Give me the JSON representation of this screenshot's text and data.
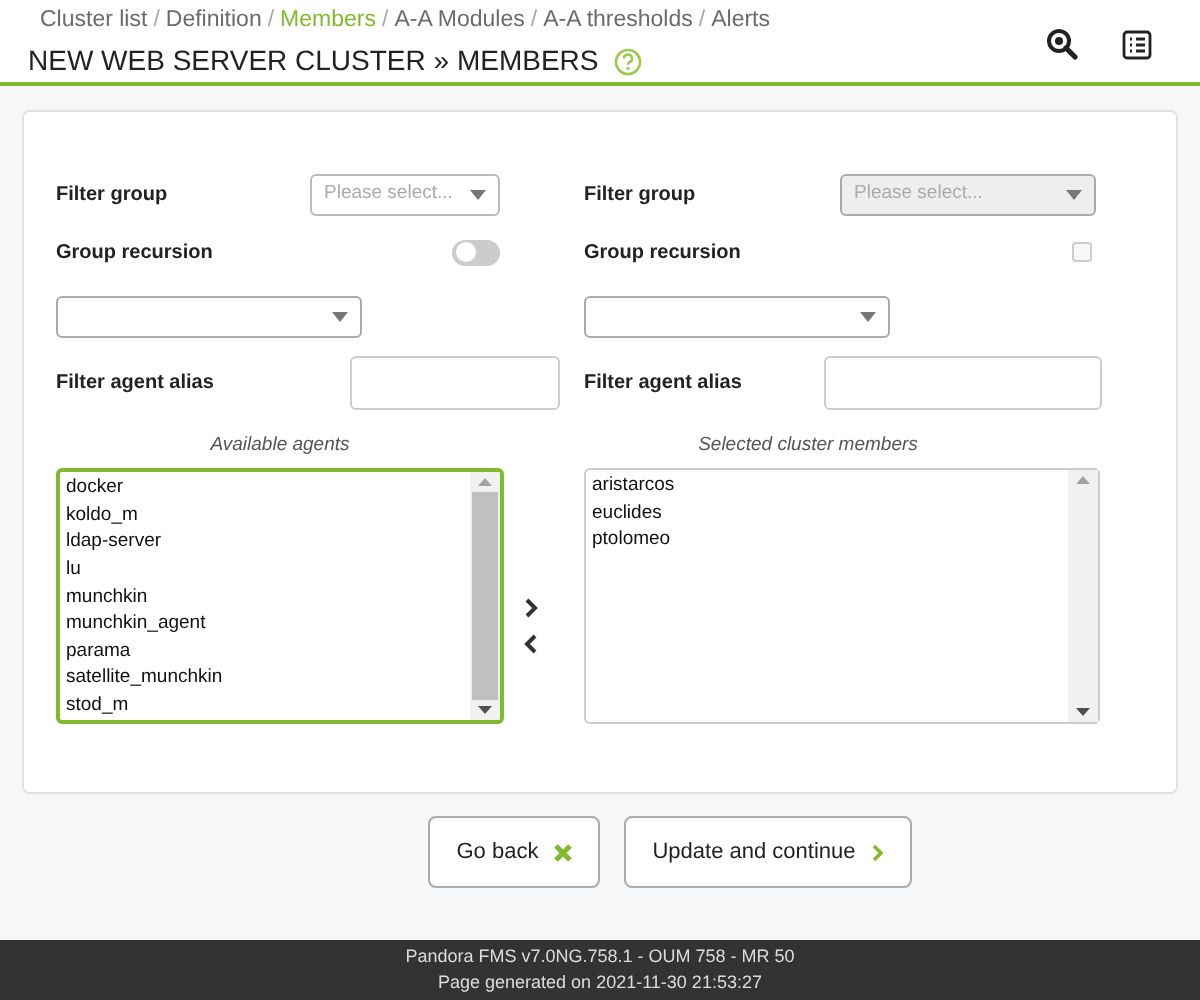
{
  "breadcrumb": [
    {
      "label": "Cluster list",
      "selected": false
    },
    {
      "separator_before": "/",
      "label": "Definition",
      "selected": false
    },
    {
      "separator_before": "/",
      "label": "Members",
      "selected": true
    },
    {
      "separator_before": "/",
      "label": "A-A Modules",
      "selected": false
    },
    {
      "separator_before": "/",
      "label": "A-A thresholds",
      "selected": false
    },
    {
      "separator_before": "/",
      "label": "Alerts",
      "selected": false
    }
  ],
  "title": "NEW WEB SERVER CLUSTER » MEMBERS",
  "panels": [
    {
      "filter_group": {
        "label": "Filter group",
        "placeholder": "Please select...",
        "disabled": false
      },
      "group_recursion": {
        "label": "Group recursion",
        "kind": "switch",
        "on": false
      },
      "filter_agent_alias": {
        "label": "Filter agent alias"
      },
      "list": {
        "title": "Available agents",
        "focused": true,
        "items": [
          "docker",
          "koldo_m",
          "ldap-server",
          "lu",
          "munchkin",
          "munchkin_agent",
          "parama",
          "satellite_munchkin",
          "stod_m"
        ]
      }
    },
    {
      "filter_group": {
        "label": "Filter group",
        "placeholder": "Please select...",
        "disabled": true
      },
      "group_recursion": {
        "label": "Group recursion",
        "kind": "checkbox",
        "on": false
      },
      "filter_agent_alias": {
        "label": "Filter agent alias"
      },
      "list": {
        "title": "Selected cluster members",
        "focused": false,
        "items": [
          "aristarcos",
          "euclides",
          "ptolomeo"
        ]
      }
    }
  ],
  "buttons": [
    {
      "label": "Go back",
      "kind": "back"
    },
    {
      "label": "Update and continue",
      "kind": "next"
    }
  ],
  "footer": [
    "Pandora FMS v7.0NG.758.1 - OUM 758 - MR 50",
    "Page generated on 2021-11-30 21:53:27"
  ]
}
